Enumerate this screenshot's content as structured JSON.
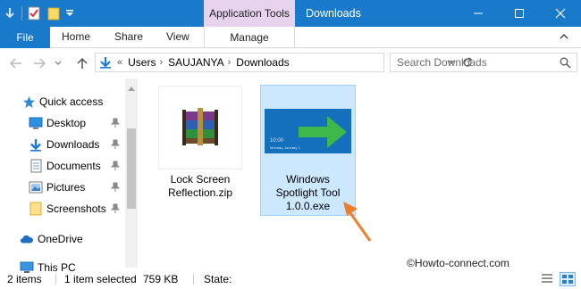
{
  "titlebar": {
    "context_tab": "Application Tools",
    "window_title": "Downloads",
    "accent": "#1979ca",
    "context_color": "#e7d3ee"
  },
  "ribbon": {
    "file": "File",
    "home": "Home",
    "share": "Share",
    "view": "View",
    "manage": "Manage"
  },
  "address": {
    "overflow": "«",
    "segments": [
      "Users",
      "SAUJANYA",
      "Downloads"
    ],
    "search_placeholder": "Search Downloads"
  },
  "nav": {
    "items": [
      {
        "label": "Quick access",
        "icon": "star-icon"
      },
      {
        "label": "Desktop",
        "icon": "desktop-icon",
        "pinned": true
      },
      {
        "label": "Downloads",
        "icon": "download-arrow-icon",
        "pinned": true
      },
      {
        "label": "Documents",
        "icon": "document-icon",
        "pinned": true
      },
      {
        "label": "Pictures",
        "icon": "picture-icon",
        "pinned": true
      },
      {
        "label": "Screenshots",
        "icon": "folder-icon",
        "pinned": true
      },
      {
        "label": "OneDrive",
        "icon": "cloud-icon"
      },
      {
        "label": "This PC",
        "icon": "computer-icon"
      }
    ]
  },
  "files": [
    {
      "name_line1": "Lock Screen",
      "name_line2": "Reflection.zip",
      "icon": "winrar-archive-icon"
    },
    {
      "name_line1": "Windows",
      "name_line2": "Spotlight Tool",
      "name_line3": "1.0.0.exe",
      "icon": "spotlight-app-icon",
      "selected": true,
      "thumb_time": "10:00",
      "thumb_date": "Monday, January 1"
    }
  ],
  "status": {
    "count": "2 items",
    "selected": "1 item selected",
    "size": "759 KB",
    "state": "State:"
  },
  "watermark": "©Howto-connect.com"
}
